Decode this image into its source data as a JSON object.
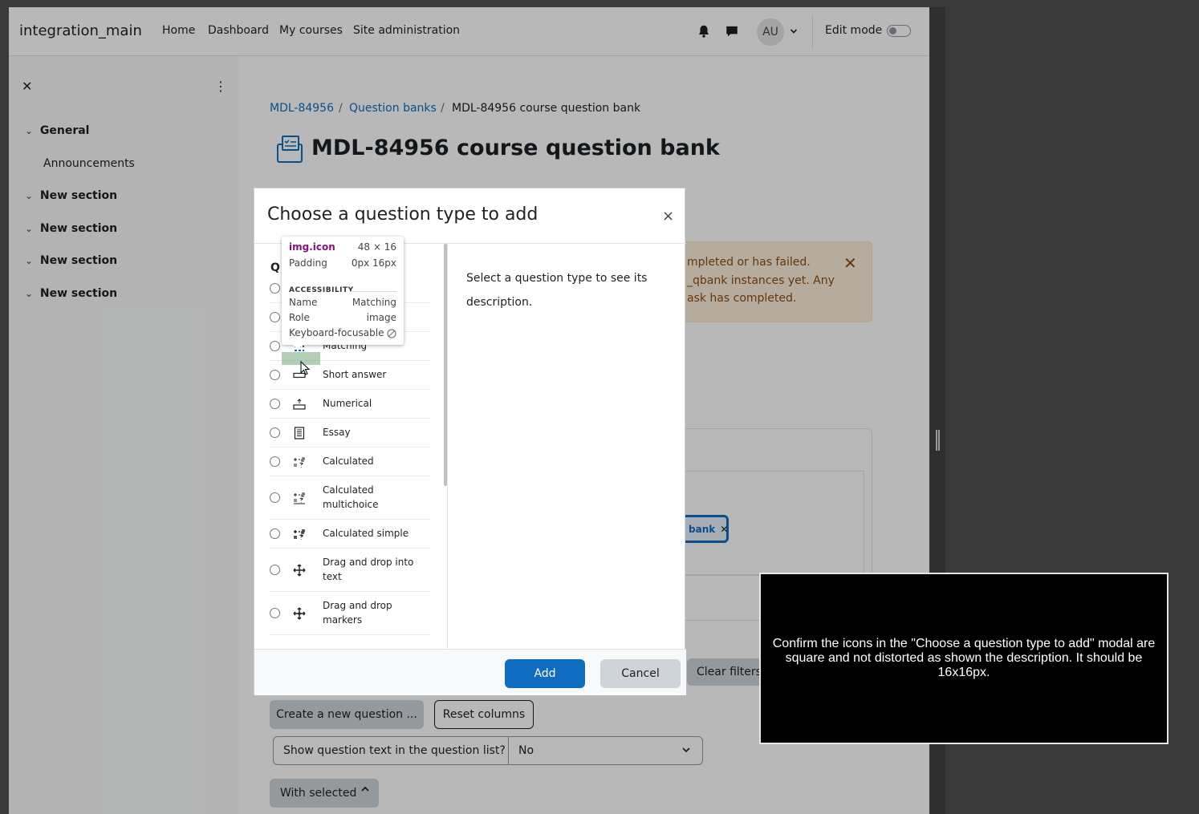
{
  "navbar": {
    "brand": "integration_main",
    "links": [
      "Home",
      "Dashboard",
      "My courses",
      "Site administration"
    ],
    "avatar_initials": "AU",
    "edit_mode_label": "Edit mode"
  },
  "drawer": {
    "sections": [
      "General",
      "New section",
      "New section",
      "New section",
      "New section"
    ],
    "item": "Announcements"
  },
  "breadcrumb": {
    "items": [
      "MDL-84956",
      "Question banks",
      "MDL-84956 course question bank"
    ],
    "separator": "/"
  },
  "page_title": "MDL-84956 course question bank",
  "alert": {
    "lines": [
      "mpleted or has failed.",
      "_qbank instances yet. Any",
      "ask has completed."
    ]
  },
  "filter_chip": {
    "label": "bank",
    "remove": "✕"
  },
  "buttons": {
    "clear_filters": "Clear filters",
    "create_question": "Create a new question ...",
    "reset_columns": "Reset columns",
    "with_selected": "With selected"
  },
  "show_text_select": {
    "label": "Show question text in the question list?",
    "value": "No"
  },
  "modal": {
    "title": "Choose a question type to add",
    "close": "×",
    "list_label": "Q",
    "question_types": [
      {
        "name": "Matching",
        "icon": "matching-icon"
      },
      {
        "name": "Short answer",
        "icon": "short-answer-icon"
      },
      {
        "name": "Numerical",
        "icon": "numerical-icon"
      },
      {
        "name": "Essay",
        "icon": "essay-icon"
      },
      {
        "name": "Calculated",
        "icon": "calculated-icon"
      },
      {
        "name": "Calculated multichoice",
        "icon": "calculated-multichoice-icon"
      },
      {
        "name": "Calculated simple",
        "icon": "calculated-simple-icon"
      },
      {
        "name": "Drag and drop into text",
        "icon": "drag-drop-text-icon"
      },
      {
        "name": "Drag and drop markers",
        "icon": "drag-drop-markers-icon"
      }
    ],
    "description": "Select a question type to see its description.",
    "add_label": "Add",
    "cancel_label": "Cancel"
  },
  "inspect_tooltip": {
    "tag": "img.icon",
    "dimensions": "48 × 16",
    "padding_label": "Padding",
    "padding_value": "0px 16px",
    "section_heading": "ACCESSIBILITY",
    "name_label": "Name",
    "name_value": "Matching",
    "role_label": "Role",
    "role_value": "image",
    "focusable_label": "Keyboard-focusable",
    "focusable_icon": "not-allowed-icon"
  },
  "instruction": "Confirm the icons in the \"Choose a question type to add\" modal are square and not distorted as shown the description. It should be 16x16px.",
  "colors": {
    "primary": "#0f6cbf",
    "alert_bg": "#fcefdc",
    "alert_text": "#8e4c0f",
    "tooltip_tag": "#881280"
  }
}
